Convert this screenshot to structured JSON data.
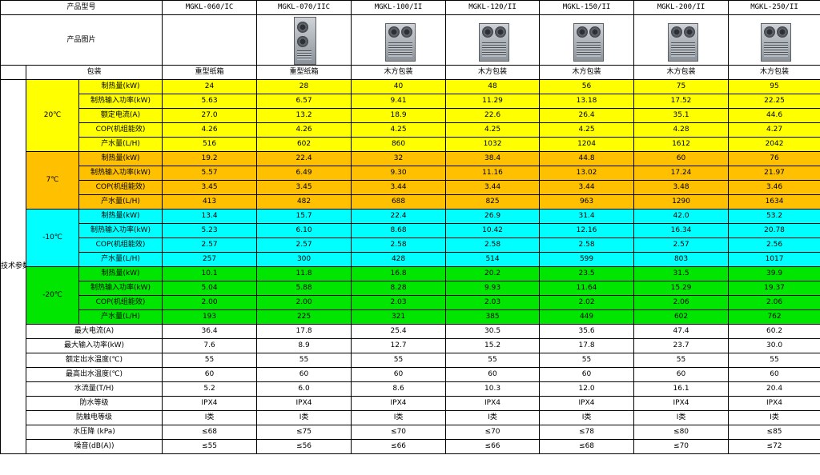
{
  "header": {
    "model_label": "产品型号",
    "image_label": "产品图片",
    "package_label": "包装",
    "tech_label": "技术参数"
  },
  "models": [
    "MGKL-060/IC",
    "MGKL-070/IIC",
    "MGKL-100/II",
    "MGKL-120/II",
    "MGKL-150/II",
    "MGKL-200/II",
    "MGKL-250/II"
  ],
  "product_images": [
    "tall-unit-image",
    "tall-unit-image",
    "box-unit-image",
    "box-unit-image",
    "box-unit-image",
    "box-unit-image",
    "box-unit-image"
  ],
  "packaging": [
    "重型纸箱",
    "重型纸箱",
    "木方包装",
    "木方包装",
    "木方包装",
    "木方包装",
    "木方包装"
  ],
  "colors": {
    "yellow": "#ffff00",
    "orange": "#ffc000",
    "cyan": "#00ffff",
    "green": "#00e600"
  },
  "conditions": [
    {
      "temp": "20℃",
      "color": "yellow",
      "rows": [
        {
          "label": "制热量(kW)",
          "values": [
            "24",
            "28",
            "40",
            "48",
            "56",
            "75",
            "95"
          ]
        },
        {
          "label": "制热输入功率(kW)",
          "values": [
            "5.63",
            "6.57",
            "9.41",
            "11.29",
            "13.18",
            "17.52",
            "22.25"
          ]
        },
        {
          "label": "额定电流(A)",
          "values": [
            "27.0",
            "13.2",
            "18.9",
            "22.6",
            "26.4",
            "35.1",
            "44.6"
          ]
        },
        {
          "label": "COP(机组能效)",
          "values": [
            "4.26",
            "4.26",
            "4.25",
            "4.25",
            "4.25",
            "4.28",
            "4.27"
          ]
        },
        {
          "label": "产水量(L/H)",
          "values": [
            "516",
            "602",
            "860",
            "1032",
            "1204",
            "1612",
            "2042"
          ]
        }
      ]
    },
    {
      "temp": "7℃",
      "color": "orange",
      "rows": [
        {
          "label": "制热量(kW)",
          "values": [
            "19.2",
            "22.4",
            "32",
            "38.4",
            "44.8",
            "60",
            "76"
          ]
        },
        {
          "label": "制热输入功率(kW)",
          "values": [
            "5.57",
            "6.49",
            "9.30",
            "11.16",
            "13.02",
            "17.24",
            "21.97"
          ]
        },
        {
          "label": "COP(机组能效)",
          "values": [
            "3.45",
            "3.45",
            "3.44",
            "3.44",
            "3.44",
            "3.48",
            "3.46"
          ]
        },
        {
          "label": "产水量(L/H)",
          "values": [
            "413",
            "482",
            "688",
            "825",
            "963",
            "1290",
            "1634"
          ]
        }
      ]
    },
    {
      "temp": "-10℃",
      "color": "cyan",
      "rows": [
        {
          "label": "制热量(kW)",
          "values": [
            "13.4",
            "15.7",
            "22.4",
            "26.9",
            "31.4",
            "42.0",
            "53.2"
          ]
        },
        {
          "label": "制热输入功率(kW)",
          "values": [
            "5.23",
            "6.10",
            "8.68",
            "10.42",
            "12.16",
            "16.34",
            "20.78"
          ]
        },
        {
          "label": "COP(机组能效)",
          "values": [
            "2.57",
            "2.57",
            "2.58",
            "2.58",
            "2.58",
            "2.57",
            "2.56"
          ]
        },
        {
          "label": "产水量(L/H)",
          "values": [
            "257",
            "300",
            "428",
            "514",
            "599",
            "803",
            "1017"
          ]
        }
      ]
    },
    {
      "temp": "-20℃",
      "color": "green",
      "rows": [
        {
          "label": "制热量(kW)",
          "values": [
            "10.1",
            "11.8",
            "16.8",
            "20.2",
            "23.5",
            "31.5",
            "39.9"
          ]
        },
        {
          "label": "制热输入功率(kW)",
          "values": [
            "5.04",
            "5.88",
            "8.28",
            "9.93",
            "11.64",
            "15.29",
            "19.37"
          ]
        },
        {
          "label": "COP(机组能效)",
          "values": [
            "2.00",
            "2.00",
            "2.03",
            "2.03",
            "2.02",
            "2.06",
            "2.06"
          ]
        },
        {
          "label": "产水量(L/H)",
          "values": [
            "193",
            "225",
            "321",
            "385",
            "449",
            "602",
            "762"
          ]
        }
      ]
    }
  ],
  "general": [
    {
      "label": "最大电流(A)",
      "values": [
        "36.4",
        "17.8",
        "25.4",
        "30.5",
        "35.6",
        "47.4",
        "60.2"
      ]
    },
    {
      "label": "最大输入功率(kW)",
      "values": [
        "7.6",
        "8.9",
        "12.7",
        "15.2",
        "17.8",
        "23.7",
        "30.0"
      ]
    },
    {
      "label": "额定出水温度(℃)",
      "values": [
        "55",
        "55",
        "55",
        "55",
        "55",
        "55",
        "55"
      ]
    },
    {
      "label": "最高出水温度(℃)",
      "values": [
        "60",
        "60",
        "60",
        "60",
        "60",
        "60",
        "60"
      ]
    },
    {
      "label": "水流量(T/H)",
      "values": [
        "5.2",
        "6.0",
        "8.6",
        "10.3",
        "12.0",
        "16.1",
        "20.4"
      ]
    },
    {
      "label": "防水等级",
      "values": [
        "IPX4",
        "IPX4",
        "IPX4",
        "IPX4",
        "IPX4",
        "IPX4",
        "IPX4"
      ]
    },
    {
      "label": "防触电等级",
      "values": [
        "I类",
        "I类",
        "I类",
        "I类",
        "I类",
        "I类",
        "I类"
      ]
    },
    {
      "label": "水压降 (kPa)",
      "values": [
        "≤68",
        "≤75",
        "≤70",
        "≤70",
        "≤78",
        "≤80",
        "≤85"
      ]
    },
    {
      "label": "噪音(dB(A))",
      "values": [
        "≤55",
        "≤56",
        "≤66",
        "≤66",
        "≤68",
        "≤70",
        "≤72"
      ]
    }
  ]
}
